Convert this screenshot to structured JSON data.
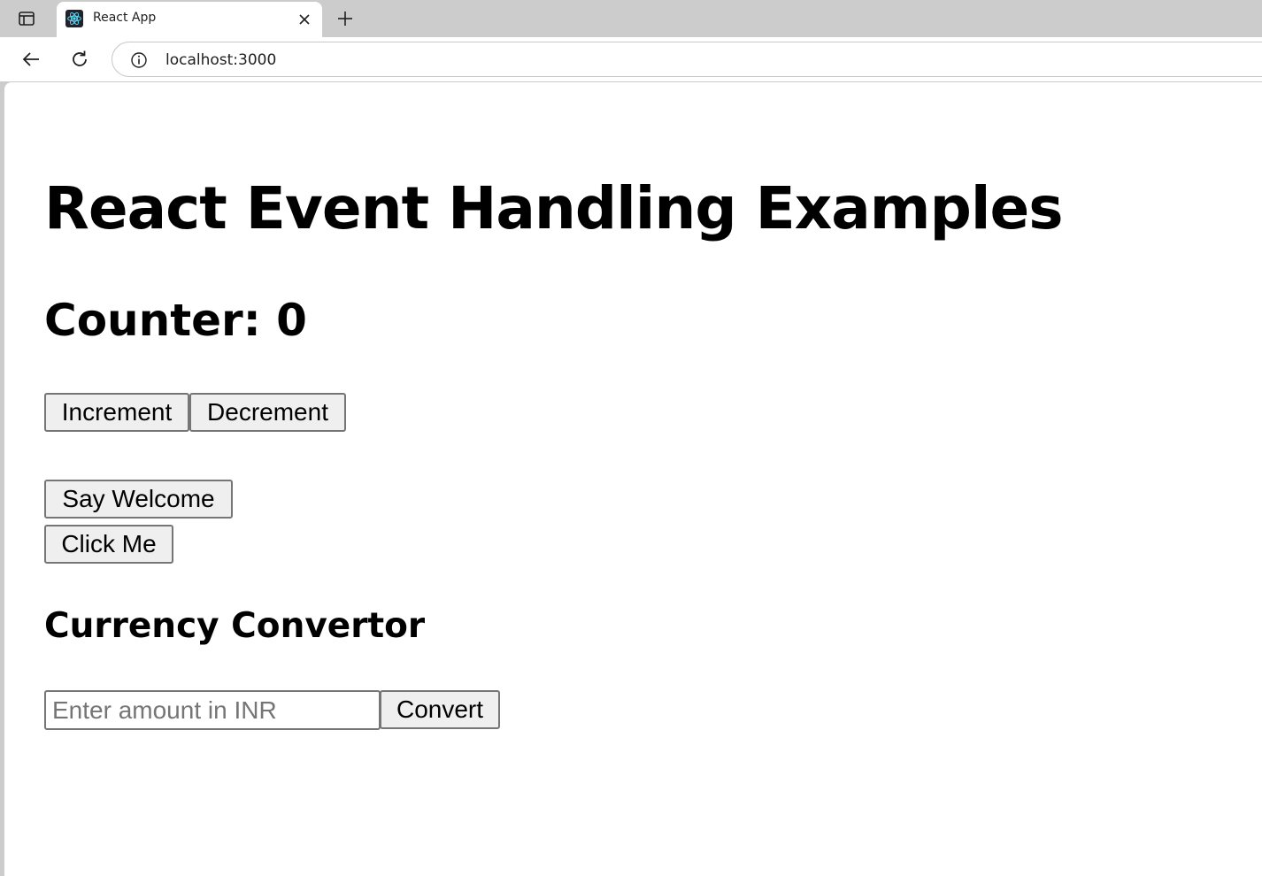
{
  "browser": {
    "tab": {
      "title": "React App",
      "favicon": "react-logo-icon"
    },
    "address_bar": {
      "url": "localhost:3000"
    },
    "icons": {
      "tab_list": "tab-list-icon",
      "close": "close-icon",
      "new_tab": "plus-icon",
      "back": "back-arrow-icon",
      "reload": "reload-icon",
      "site_info": "info-icon"
    }
  },
  "page": {
    "title": "React Event Handling Examples",
    "counter": {
      "label": "Counter: 0",
      "increment_label": "Increment",
      "decrement_label": "Decrement"
    },
    "say_welcome_label": "Say Welcome",
    "click_me_label": "Click Me",
    "currency": {
      "title": "Currency Convertor",
      "input_placeholder": "Enter amount in INR",
      "input_value": "",
      "convert_label": "Convert"
    }
  },
  "colors": {
    "tabbar_bg": "#cccccc",
    "button_bg": "#efefef",
    "button_border": "#767676",
    "react_blue": "#61dafb"
  }
}
